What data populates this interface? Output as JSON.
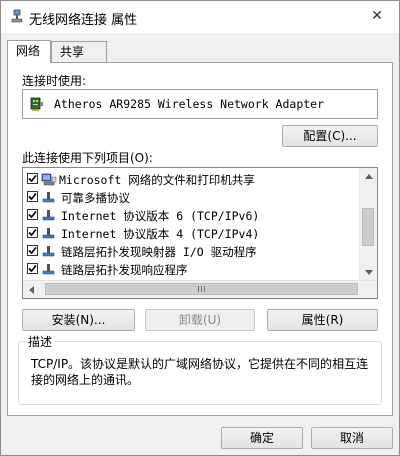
{
  "window": {
    "title": "无线网络连接 属性",
    "close_symbol": "✕"
  },
  "tabs": [
    {
      "label": "网络"
    },
    {
      "label": "共享"
    }
  ],
  "connect_using": {
    "label": "连接时使用:",
    "adapter_name": "Atheros AR9285 Wireless Network Adapter",
    "adapter_icon": "network-adapter-icon"
  },
  "configure_button": {
    "label": "配置(C)..."
  },
  "items_section": {
    "label": "此连接使用下列项目(O):"
  },
  "items": [
    {
      "label": "Microsoft 网络的文件和打印机共享",
      "checked": true,
      "icon": "file-printer-sharing-icon"
    },
    {
      "label": "可靠多播协议",
      "checked": true,
      "icon": "protocol-icon"
    },
    {
      "label": "Internet 协议版本 6 (TCP/IPv6)",
      "checked": true,
      "icon": "protocol-icon"
    },
    {
      "label": "Internet 协议版本 4 (TCP/IPv4)",
      "checked": true,
      "icon": "protocol-icon"
    },
    {
      "label": "链路层拓扑发现映射器 I/O 驱动程序",
      "checked": true,
      "icon": "protocol-icon"
    },
    {
      "label": "链路层拓扑发现响应程序",
      "checked": true,
      "icon": "protocol-icon"
    }
  ],
  "item_buttons": {
    "install": "安装(N)...",
    "uninstall": "卸载(U)",
    "properties": "属性(R)"
  },
  "description": {
    "legend": "描述",
    "text": "TCP/IP。该协议是默认的广域网络协议，它提供在不同的相互连接的网络上的通讯。"
  },
  "dialog_buttons": {
    "ok": "确定",
    "cancel": "取消"
  },
  "colors": {
    "background": "#f0f0f0",
    "panel": "#ffffff",
    "border": "#a0a0a0",
    "disabled_text": "#8a8a8a"
  }
}
